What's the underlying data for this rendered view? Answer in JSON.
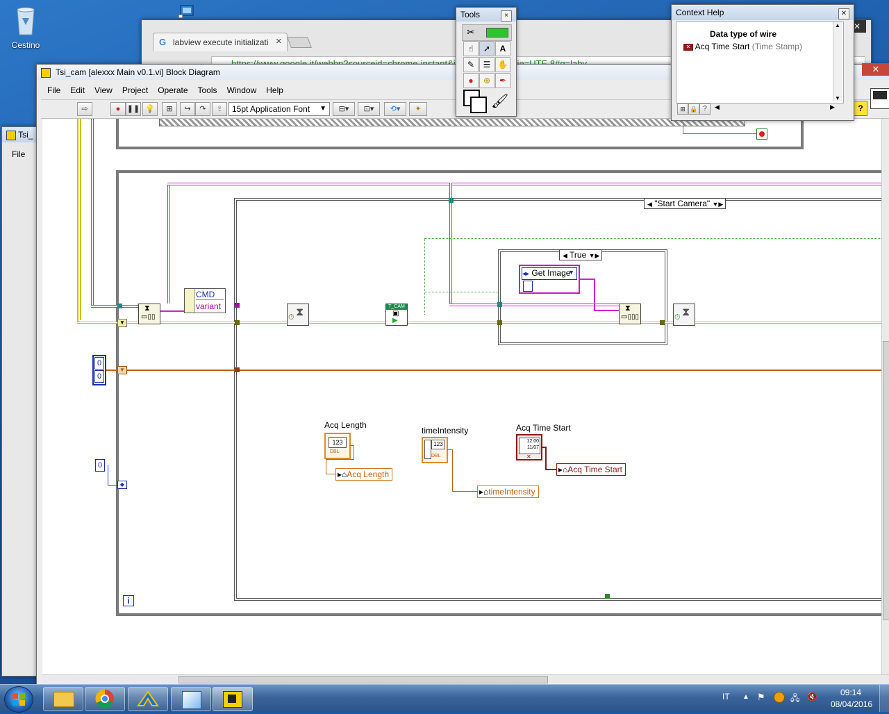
{
  "desktop": {
    "recycle_bin_label": "Cestino"
  },
  "browser": {
    "tab_title": "labview execute initializati",
    "tab_close": "×",
    "url": "https://www.google.it/webhp?sourceid=chrome-instant&ion=1&espv=2&ie=UTF-8#q=labv"
  },
  "back_window": {
    "title": "Tsi_",
    "menu_file": "File"
  },
  "main_window": {
    "title": "Tsi_cam [alexxx Main v0.1.vi] Block Diagram",
    "menu": [
      "File",
      "Edit",
      "View",
      "Project",
      "Operate",
      "Tools",
      "Window",
      "Help"
    ],
    "font_selector": "15pt Application Font"
  },
  "tools_palette": {
    "title": "Tools",
    "close": "×"
  },
  "context_help": {
    "title": "Context Help",
    "heading": "Data type of wire",
    "wire_name": "Acq Time Start",
    "wire_type": "(Time Stamp)"
  },
  "diagram": {
    "case_main_selector": "\"Start Camera\"",
    "case_inner_selector": "True",
    "enum_const": "Get Image",
    "cluster_labels": {
      "cmd": "CMD",
      "variant": "variant"
    },
    "camera_node": "T_CAM",
    "numeric_consts": [
      "0",
      "0",
      "0"
    ],
    "loop_index": "i",
    "indicators": {
      "acq_length": {
        "label": "Acq Length",
        "local": "Acq Length",
        "glyph": "123",
        "type": "DBL"
      },
      "time_intensity": {
        "label": "timeIntensity",
        "local": "timeIntensity",
        "glyph": "123",
        "type": "DBL"
      },
      "acq_time_start": {
        "label": "Acq Time Start",
        "local": "Acq Time Start",
        "glyph": "12:00 11/07"
      }
    }
  },
  "taskbar": {
    "language": "IT",
    "time": "09:14",
    "date": "08/04/2016"
  },
  "colors": {
    "wire_error": "#c8c400",
    "wire_queue": "#d020d0",
    "wire_dbl": "#c86010",
    "wire_int": "#2040c8",
    "wire_bool": "#3aa030",
    "timestamp": "#8a1a1a"
  }
}
